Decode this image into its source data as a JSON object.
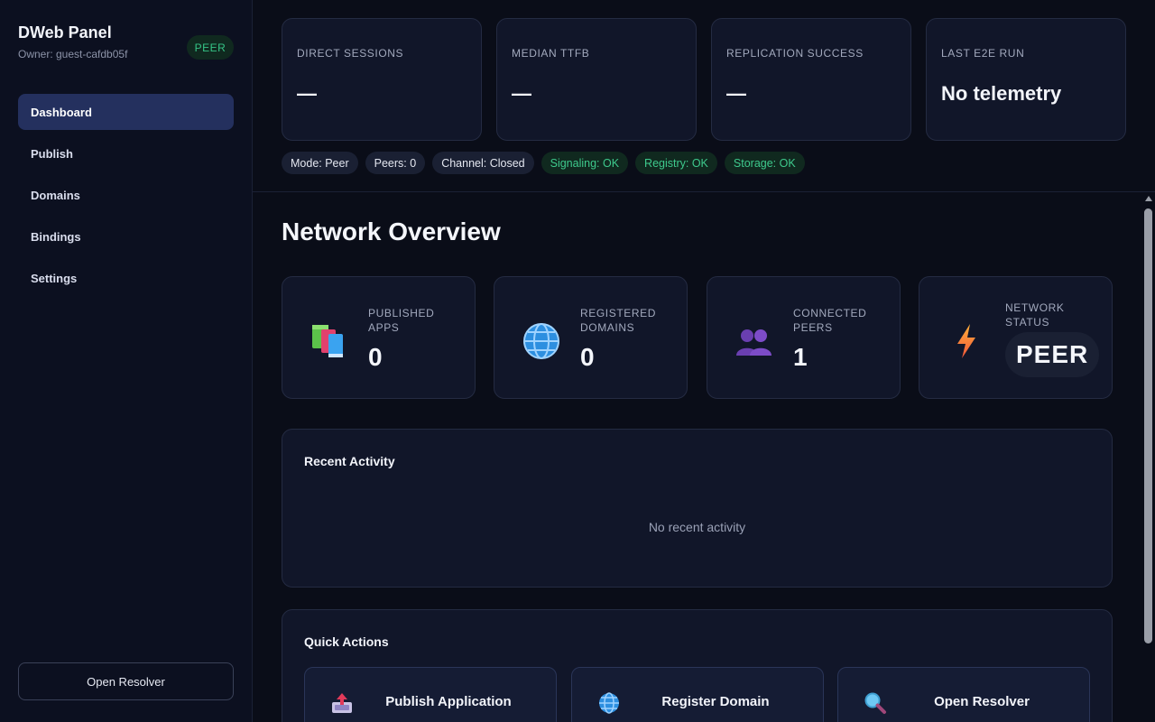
{
  "app": {
    "title": "DWeb Panel",
    "owner": "Owner: guest-cafdb05f",
    "role_badge": "PEER"
  },
  "nav": {
    "items": [
      {
        "label": "Dashboard",
        "active": true
      },
      {
        "label": "Publish"
      },
      {
        "label": "Domains"
      },
      {
        "label": "Bindings"
      },
      {
        "label": "Settings"
      }
    ],
    "open_resolver_label": "Open Resolver"
  },
  "telemetry": {
    "metrics": [
      {
        "label": "DIRECT SESSIONS",
        "value": "—"
      },
      {
        "label": "MEDIAN TTFB",
        "value": "—"
      },
      {
        "label": "REPLICATION SUCCESS",
        "value": "—"
      },
      {
        "label": "LAST E2E RUN",
        "value": "No telemetry"
      }
    ],
    "pills": [
      {
        "label": "Mode: Peer",
        "status": "neutral"
      },
      {
        "label": "Peers: 0",
        "status": "neutral"
      },
      {
        "label": "Channel: Closed",
        "status": "neutral"
      },
      {
        "label": "Signaling: OK",
        "status": "ok"
      },
      {
        "label": "Registry: OK",
        "status": "ok"
      },
      {
        "label": "Storage: OK",
        "status": "ok"
      }
    ]
  },
  "overview": {
    "title": "Network Overview",
    "stats": [
      {
        "label": "PUBLISHED APPS",
        "value": "0",
        "icon": "books-icon"
      },
      {
        "label": "REGISTERED DOMAINS",
        "value": "0",
        "icon": "globe-icon"
      },
      {
        "label": "CONNECTED PEERS",
        "value": "1",
        "icon": "people-icon"
      },
      {
        "label": "NETWORK STATUS",
        "value": "PEER",
        "icon": "lightning-icon"
      }
    ]
  },
  "recent_activity": {
    "title": "Recent Activity",
    "empty_text": "No recent activity"
  },
  "quick_actions": {
    "title": "Quick Actions",
    "buttons": [
      {
        "label": "Publish Application",
        "icon": "outbox-tray-icon"
      },
      {
        "label": "Register Domain",
        "icon": "globe-icon"
      },
      {
        "label": "Open Resolver",
        "icon": "magnifier-icon"
      }
    ]
  },
  "colors": {
    "background": "#0a0d18",
    "card": "#111629",
    "nav_active": "#24305e",
    "ok_green": "#3ec98c"
  }
}
